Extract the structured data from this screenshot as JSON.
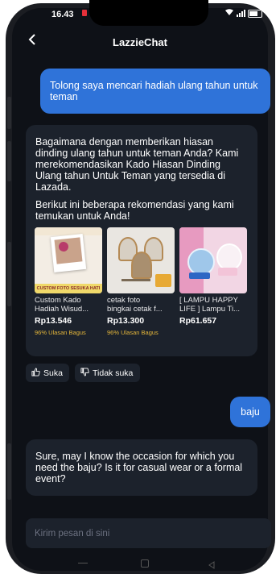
{
  "status": {
    "time": "16.43"
  },
  "header": {
    "title": "LazzieChat"
  },
  "messages": {
    "user1": "Tolong saya mencari hadiah ulang tahun untuk teman",
    "bot1_intro": "Bagaimana dengan memberikan hiasan dinding ulang tahun untuk teman Anda? Kami merekomendasikan Kado Hiasan Dinding Ulang tahun Untuk Teman yang tersedia di Lazada.",
    "bot1_followup": "Berikut ini beberapa rekomendasi yang kami temukan untuk Anda!",
    "user2": "baju",
    "bot2": "Sure, may I know the occasion for which you need the baju? Is it for casual wear or a formal event?"
  },
  "products": [
    {
      "name": "Custom Kado\nHadiah Wisud...",
      "price": "Rp13.546",
      "rating": "96% Ulasan Bagus",
      "img_caption": "CUSTOM FOTO SESUKA HATI"
    },
    {
      "name": "cetak foto\nbingkai cetak f...",
      "price": "Rp13.300",
      "rating": "96% Ulasan Bagus",
      "img_caption": ""
    },
    {
      "name": "[ LAMPU HAPPY\nLIFE ] Lampu Ti...",
      "price": "Rp61.657",
      "rating": "",
      "img_caption": ""
    }
  ],
  "feedback": {
    "like": "Suka",
    "dislike": "Tidak suka"
  },
  "input": {
    "placeholder": "Kirim pesan di sini"
  },
  "colors": {
    "accent": "#2f73d9",
    "rating": "#e3b53a",
    "background": "#0e1117",
    "bubble": "#1c222c"
  }
}
